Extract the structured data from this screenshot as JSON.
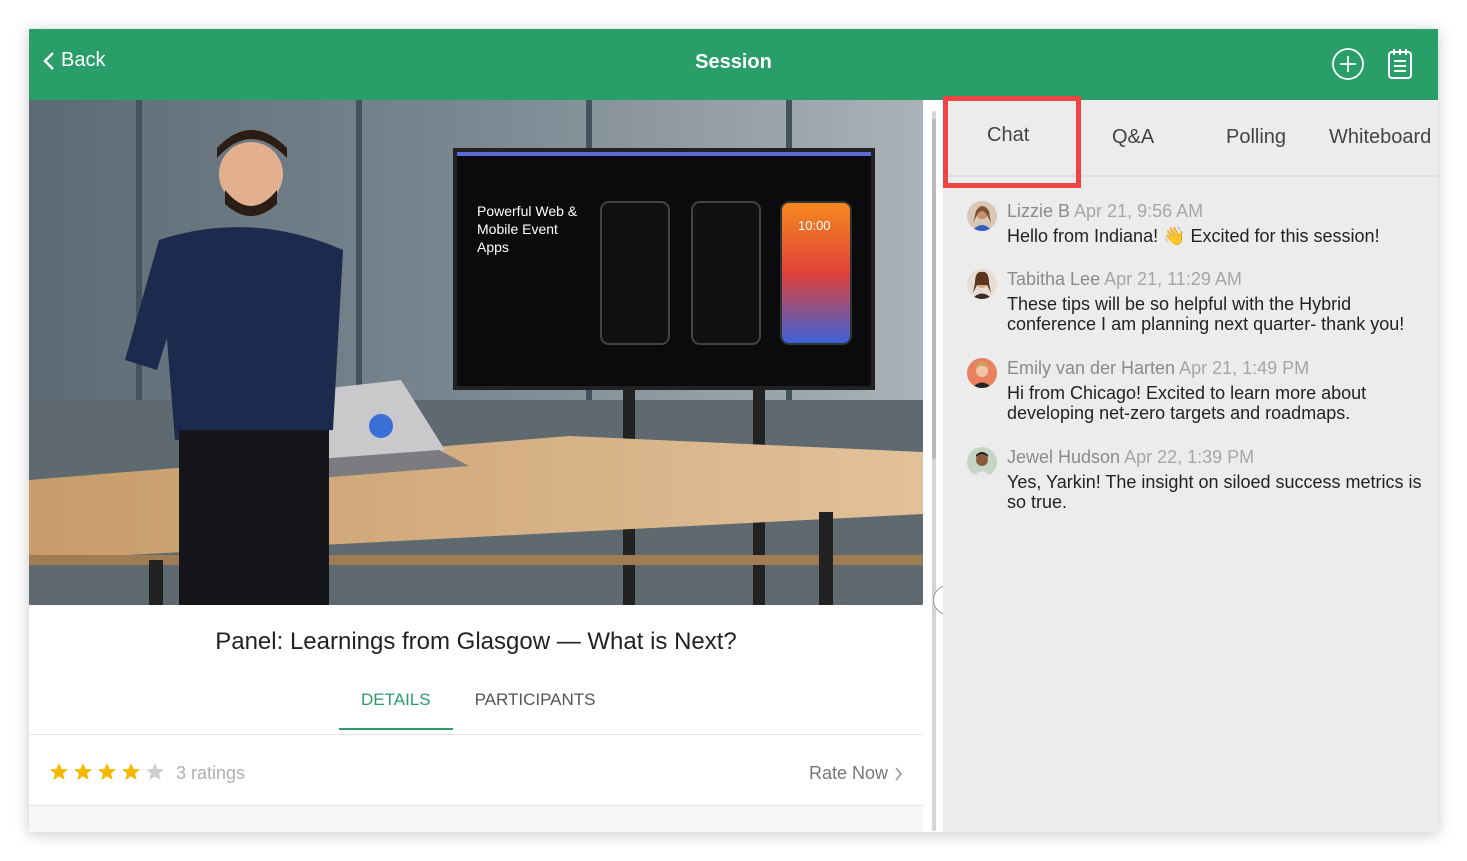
{
  "header": {
    "back_label": "Back",
    "title": "Session"
  },
  "session": {
    "title": "Panel: Learnings from Glasgow — What is Next?",
    "tabs": [
      "DETAILS",
      "PARTICIPANTS"
    ],
    "active_tab": "DETAILS",
    "rating_stars": 4,
    "rating_max": 5,
    "ratings_text": "3 ratings",
    "rate_now_label": "Rate Now"
  },
  "video": {
    "screen_text": "Powerful Web & Mobile Event Apps",
    "phone_clock": "10:00"
  },
  "panel": {
    "tabs": [
      "Chat",
      "Q&A",
      "Polling",
      "Whiteboard"
    ],
    "active_tab": "Chat"
  },
  "messages": [
    {
      "name": "Lizzie B",
      "time": "Apr 21, 9:56 AM",
      "text": "Hello from Indiana! 👋 Excited for this session!"
    },
    {
      "name": "Tabitha Lee",
      "time": "Apr 21, 11:29 AM",
      "text": "These tips will be so helpful with the Hybrid conference I am planning next quarter- thank you!"
    },
    {
      "name": "Emily van der Harten",
      "time": "Apr 21, 1:49 PM",
      "text": "Hi from Chicago! Excited to learn more about developing net-zero targets and roadmaps."
    },
    {
      "name": "Jewel Hudson",
      "time": "Apr 22, 1:39 PM",
      "text": "Yes, Yarkin! The insight on siloed success metrics is so true."
    }
  ],
  "colors": {
    "brand_green": "#2a9e68",
    "highlight_red": "#ee4444",
    "star_gold": "#f5b800"
  },
  "icons": [
    "chevron-left-icon",
    "plus-circle-icon",
    "notepad-icon",
    "star-icon",
    "chevron-right-icon"
  ]
}
